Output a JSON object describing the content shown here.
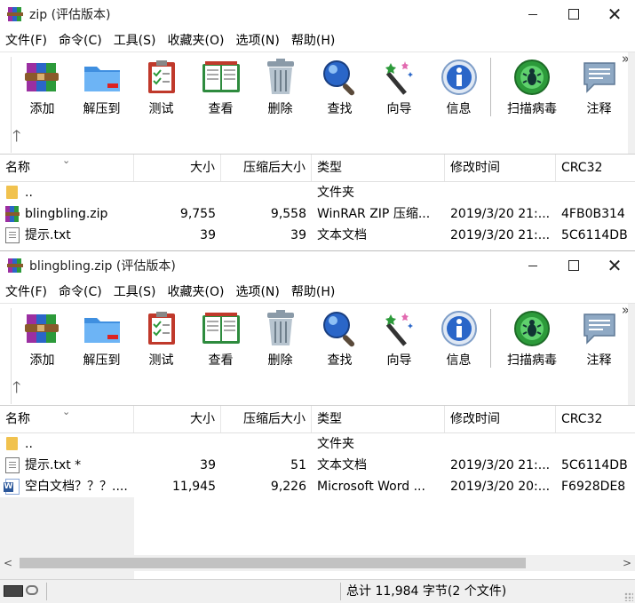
{
  "window1": {
    "title": "zip (评估版本)",
    "menu": [
      "文件(F)",
      "命令(C)",
      "工具(S)",
      "收藏夹(O)",
      "选项(N)",
      "帮助(H)"
    ],
    "toolbar": [
      "添加",
      "解压到",
      "测试",
      "查看",
      "删除",
      "查找",
      "向导",
      "信息",
      "扫描病毒",
      "注释"
    ],
    "columns": [
      "名称",
      "大小",
      "压缩后大小",
      "类型",
      "修改时间",
      "CRC32"
    ],
    "rows": [
      {
        "icon": "folder-icon",
        "name": "..",
        "size": "",
        "packed": "",
        "type": "文件夹",
        "modified": "",
        "crc": ""
      },
      {
        "icon": "zip-archive-icon",
        "name": "blingbling.zip",
        "size": "9,755",
        "packed": "9,558",
        "type": "WinRAR ZIP 压缩...",
        "modified": "2019/3/20 21:...",
        "crc": "4FB0B314"
      },
      {
        "icon": "text-file-icon",
        "name": "提示.txt",
        "size": "39",
        "packed": "39",
        "type": "文本文档",
        "modified": "2019/3/20 21:...",
        "crc": "5C6114DB"
      }
    ]
  },
  "window2": {
    "title": "blingbling.zip (评估版本)",
    "menu": [
      "文件(F)",
      "命令(C)",
      "工具(S)",
      "收藏夹(O)",
      "选项(N)",
      "帮助(H)"
    ],
    "toolbar": [
      "添加",
      "解压到",
      "测试",
      "查看",
      "删除",
      "查找",
      "向导",
      "信息",
      "扫描病毒",
      "注释"
    ],
    "columns": [
      "名称",
      "大小",
      "压缩后大小",
      "类型",
      "修改时间",
      "CRC32"
    ],
    "rows": [
      {
        "icon": "folder-icon",
        "name": "..",
        "size": "",
        "packed": "",
        "type": "文件夹",
        "modified": "",
        "crc": ""
      },
      {
        "icon": "text-file-icon",
        "name": "提示.txt *",
        "size": "39",
        "packed": "51",
        "type": "文本文档",
        "modified": "2019/3/20 21:...",
        "crc": "5C6114DB"
      },
      {
        "icon": "word-doc-icon",
        "name": "空白文档？？？....",
        "size": "11,945",
        "packed": "9,226",
        "type": "Microsoft Word ...",
        "modified": "2019/3/20 20:...",
        "crc": "F6928DE8"
      }
    ],
    "status": "总计 11,984 字节(2 个文件)"
  }
}
